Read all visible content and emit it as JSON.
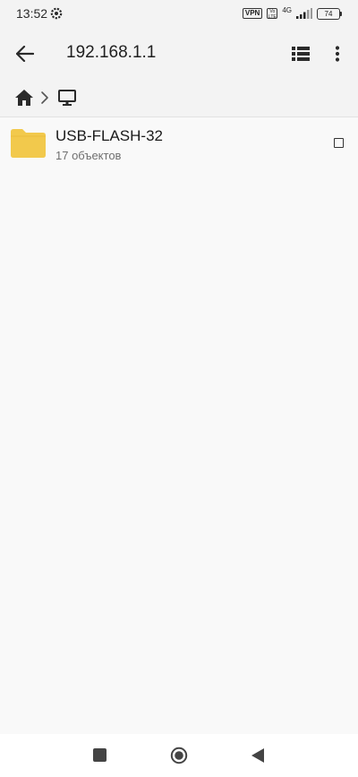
{
  "status_bar": {
    "time": "13:52",
    "vpn_label": "VPN",
    "volte_label": "Vo LTE",
    "network_type": "4G",
    "battery_level": "74"
  },
  "app_bar": {
    "title": "192.168.1.1",
    "icons": [
      "back-arrow-icon",
      "list-view-icon",
      "more-vert-icon"
    ]
  },
  "breadcrumb": {
    "items": [
      "home-icon",
      "computer-icon"
    ]
  },
  "files": [
    {
      "name": "USB-FLASH-32",
      "meta": "17 объектов",
      "type": "folder",
      "selected": false
    }
  ],
  "colors": {
    "folder": "#f2c94c",
    "background": "#f9f9f9",
    "bar": "#f3f3f3",
    "icon": "#333333"
  }
}
